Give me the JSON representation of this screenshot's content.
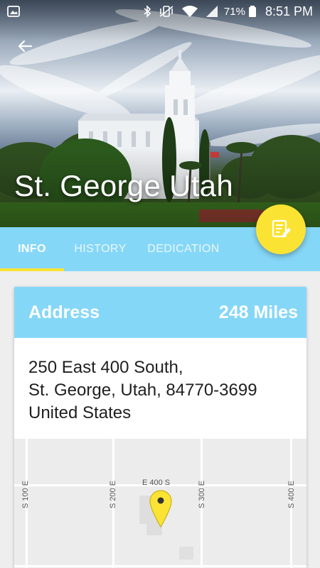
{
  "status_bar": {
    "battery": "71%",
    "time": "8:51 PM",
    "icons": [
      "gallery-icon",
      "bluetooth-icon",
      "vibrate-icon",
      "wifi-icon",
      "signal-icon",
      "battery-icon"
    ]
  },
  "header": {
    "title": "St. George Utah",
    "back_icon": "arrow-left-icon"
  },
  "tabs": [
    {
      "label": "INFO",
      "active": true
    },
    {
      "label": "HISTORY",
      "active": false
    },
    {
      "label": "DEDICATION",
      "active": false
    }
  ],
  "fab": {
    "icon": "note-edit-icon"
  },
  "address_card": {
    "label": "Address",
    "distance": "248 Miles",
    "lines": [
      "250 East 400 South,",
      "St. George, Utah, 84770-3699",
      "United States"
    ]
  },
  "map": {
    "streets": [
      "S 100 E",
      "S 200 E",
      "E 400 S",
      "S 300 E",
      "S 400 E"
    ],
    "pin_icon": "map-pin-icon"
  },
  "colors": {
    "accent": "#85d7f7",
    "fab": "#fbe334",
    "tab_indicator": "#fbe334"
  }
}
